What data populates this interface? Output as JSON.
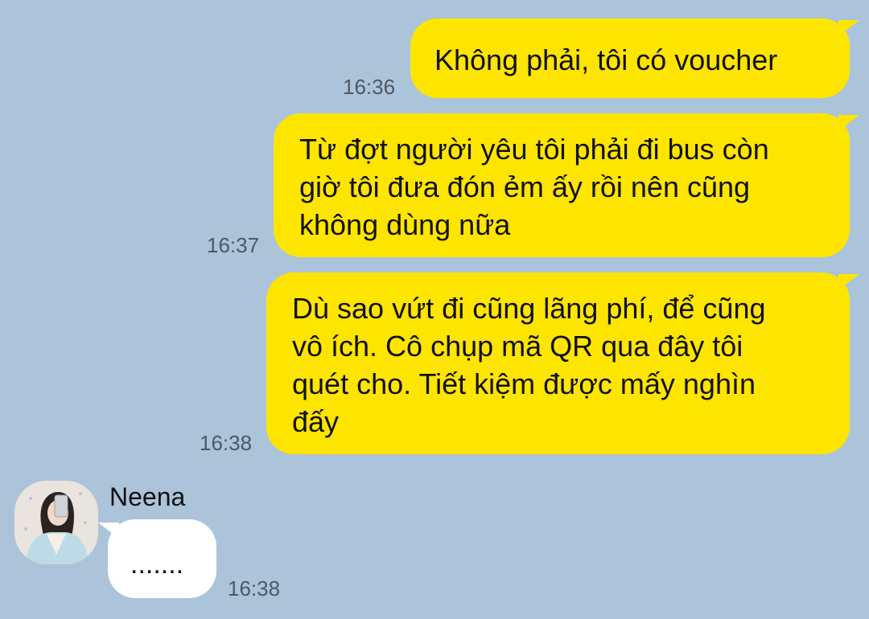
{
  "conversation": {
    "messages": [
      {
        "direction": "outgoing",
        "text": "Không phải, tôi có voucher",
        "time": "16:36"
      },
      {
        "direction": "outgoing",
        "lines": [
          "Từ đợt người yêu tôi phải đi bus còn",
          "giờ tôi đưa đón ẻm ấy rồi nên cũng",
          "không dùng nữa"
        ],
        "time": "16:37"
      },
      {
        "direction": "outgoing",
        "lines": [
          "Dù sao vứt đi cũng lãng phí, để cũng",
          "vô ích. Cô chụp mã QR qua đây tôi",
          "quét cho. Tiết kiệm được mấy nghìn",
          "đấy"
        ],
        "time": "16:38"
      },
      {
        "direction": "incoming",
        "sender": "Neena",
        "avatar_icon": "profile-photo-icon",
        "text": ".......",
        "time": "16:38"
      }
    ]
  },
  "theme": {
    "background": "#abc4da",
    "outgoing_bubble": "#fee500",
    "incoming_bubble": "#ffffff",
    "timestamp_color": "#4e5863"
  }
}
